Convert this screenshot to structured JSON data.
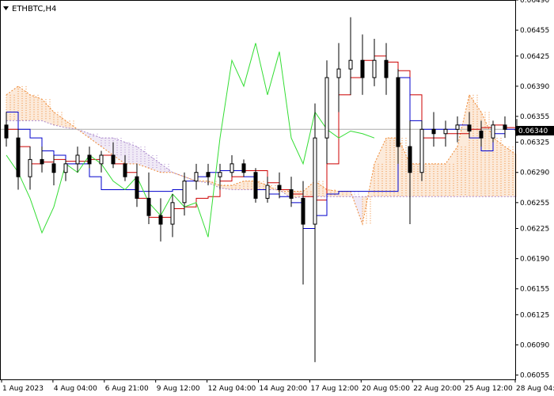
{
  "chart_data": {
    "type": "candlestick",
    "title": "ETHBTC,H4",
    "current_price": "0.06340",
    "ylim": [
      0.0605,
      0.0649
    ],
    "y_ticks": [
      "0.06490",
      "0.06455",
      "0.06425",
      "0.06390",
      "0.06355",
      "0.06325",
      "0.06290",
      "0.06255",
      "0.06225",
      "0.06190",
      "0.06155",
      "0.06125",
      "0.06090",
      "0.06055"
    ],
    "x_ticks": [
      "1 Aug 2023",
      "4 Aug 04:00",
      "6 Aug 21:00",
      "9 Aug 12:00",
      "12 Aug 04:00",
      "14 Aug 20:00",
      "17 Aug 12:00",
      "20 Aug 05:00",
      "22 Aug 20:00",
      "25 Aug 12:00",
      "28 Aug 04:00"
    ],
    "colors": {
      "candle": "#000000",
      "tenkan_sen": "#cc0000",
      "kijun_sen": "#0000cc",
      "chikou_span": "#33dd33",
      "cloud_up": "#ee8833",
      "cloud_down": "#aa88cc",
      "price_line": "#aaaaaa",
      "axis": "#000000"
    },
    "series": [
      {
        "name": "Tenkan-sen",
        "values": [
          0.0634,
          0.0632,
          0.063,
          0.06302,
          0.06305,
          0.06303,
          0.06303,
          0.06305,
          0.0631,
          0.063,
          0.0629,
          0.0626,
          0.06238,
          0.06238,
          0.06248,
          0.0625,
          0.0626,
          0.06262,
          0.0628,
          0.06285,
          0.06292,
          0.06292,
          0.06278,
          0.0627,
          0.06265,
          0.06262,
          0.06258,
          0.063,
          0.0638,
          0.064,
          0.0642,
          0.06425,
          0.06418,
          0.06408,
          0.0638,
          0.0633,
          0.0633,
          0.06335,
          0.06335,
          0.0634,
          0.06342,
          0.06345,
          0.06342,
          0.06338
        ]
      },
      {
        "name": "Kijun-sen",
        "values": [
          0.0636,
          0.0634,
          0.0633,
          0.06315,
          0.0631,
          0.063,
          0.063,
          0.06285,
          0.0627,
          0.0627,
          0.0627,
          0.06268,
          0.06268,
          0.06268,
          0.0627,
          0.0628,
          0.06285,
          0.0629,
          0.06292,
          0.06292,
          0.06285,
          0.0627,
          0.06265,
          0.06262,
          0.06255,
          0.06225,
          0.0624,
          0.06265,
          0.06268,
          0.06268,
          0.06268,
          0.06268,
          0.06268,
          0.064,
          0.0635,
          0.0634,
          0.0634,
          0.0634,
          0.06345,
          0.0633,
          0.06315,
          0.06335,
          0.0634,
          0.0634
        ]
      },
      {
        "name": "Chikou Span",
        "values": [
          0.0631,
          0.0629,
          0.0626,
          0.0622,
          0.0625,
          0.063,
          0.0629,
          0.0631,
          0.063,
          0.0628,
          0.0627,
          0.06285,
          0.06255,
          0.0624,
          0.06265,
          0.0625,
          0.06255,
          0.06215,
          0.0633,
          0.0642,
          0.0639,
          0.0644,
          0.0638,
          0.0643,
          0.0633,
          0.063,
          0.0636,
          0.0634,
          0.0633,
          0.06338,
          0.06335,
          0.0633
        ]
      },
      {
        "name": "Senkou Span A",
        "values": [
          0.0638,
          0.0639,
          0.0638,
          0.06375,
          0.0636,
          0.0635,
          0.0634,
          0.0633,
          0.0632,
          0.0631,
          0.063,
          0.063,
          0.06295,
          0.0629,
          0.0629,
          0.06285,
          0.0628,
          0.0628,
          0.06275,
          0.06275,
          0.0628,
          0.0628,
          0.06275,
          0.06268,
          0.06268,
          0.06268,
          0.0628,
          0.0627,
          0.06268,
          0.06268,
          0.0623,
          0.063,
          0.0633,
          0.0633,
          0.063,
          0.063,
          0.063,
          0.063,
          0.0632,
          0.0638,
          0.0636,
          0.0633,
          0.0632,
          0.0631
        ]
      },
      {
        "name": "Senkou Span B",
        "values": [
          0.0635,
          0.0635,
          0.0635,
          0.0635,
          0.06345,
          0.06342,
          0.0634,
          0.06335,
          0.0633,
          0.0633,
          0.06325,
          0.0632,
          0.0631,
          0.063,
          0.0629,
          0.06285,
          0.0628,
          0.06278,
          0.06272,
          0.0627,
          0.0627,
          0.0627,
          0.0627,
          0.0627,
          0.0626,
          0.06262,
          0.06262,
          0.06262,
          0.06262,
          0.06262,
          0.06262,
          0.06262,
          0.06262,
          0.06262,
          0.06262,
          0.06262,
          0.06262,
          0.06262,
          0.06262,
          0.06262,
          0.06262,
          0.06262,
          0.06262,
          0.06262
        ]
      }
    ],
    "candles": [
      [
        0.06345,
        0.0636,
        0.0632,
        0.0633
      ],
      [
        0.0633,
        0.0634,
        0.0627,
        0.06285
      ],
      [
        0.06285,
        0.0632,
        0.0627,
        0.06305
      ],
      [
        0.06305,
        0.0632,
        0.0629,
        0.063
      ],
      [
        0.063,
        0.0631,
        0.06275,
        0.0629
      ],
      [
        0.0629,
        0.06305,
        0.0628,
        0.063
      ],
      [
        0.063,
        0.0632,
        0.0629,
        0.0631
      ],
      [
        0.0631,
        0.0632,
        0.06295,
        0.063
      ],
      [
        0.063,
        0.06315,
        0.0629,
        0.0631
      ],
      [
        0.0631,
        0.06325,
        0.06295,
        0.063
      ],
      [
        0.063,
        0.0631,
        0.0628,
        0.06285
      ],
      [
        0.06285,
        0.063,
        0.0625,
        0.0626
      ],
      [
        0.0626,
        0.0629,
        0.0623,
        0.0624
      ],
      [
        0.0624,
        0.0626,
        0.0621,
        0.0623
      ],
      [
        0.0623,
        0.06265,
        0.06215,
        0.06255
      ],
      [
        0.06255,
        0.0629,
        0.0624,
        0.0628
      ],
      [
        0.0628,
        0.063,
        0.0627,
        0.0629
      ],
      [
        0.0629,
        0.063,
        0.06275,
        0.06285
      ],
      [
        0.06285,
        0.063,
        0.0627,
        0.0629
      ],
      [
        0.0629,
        0.0631,
        0.06285,
        0.063
      ],
      [
        0.063,
        0.06305,
        0.06285,
        0.0629
      ],
      [
        0.0629,
        0.06295,
        0.06255,
        0.0626
      ],
      [
        0.0626,
        0.06285,
        0.06255,
        0.06275
      ],
      [
        0.06275,
        0.0629,
        0.0626,
        0.0627
      ],
      [
        0.0627,
        0.06285,
        0.0625,
        0.0626
      ],
      [
        0.0626,
        0.0628,
        0.0616,
        0.0623
      ],
      [
        0.0623,
        0.0637,
        0.0607,
        0.0633
      ],
      [
        0.0633,
        0.0642,
        0.063,
        0.064
      ],
      [
        0.064,
        0.0644,
        0.0636,
        0.0641
      ],
      [
        0.0641,
        0.0647,
        0.0638,
        0.0642
      ],
      [
        0.0642,
        0.0645,
        0.0638,
        0.064
      ],
      [
        0.064,
        0.06445,
        0.0639,
        0.0642
      ],
      [
        0.0642,
        0.0644,
        0.0638,
        0.064
      ],
      [
        0.064,
        0.0641,
        0.063,
        0.0632
      ],
      [
        0.0632,
        0.0635,
        0.0623,
        0.0629
      ],
      [
        0.0629,
        0.0635,
        0.0628,
        0.0634
      ],
      [
        0.0634,
        0.0636,
        0.0632,
        0.06335
      ],
      [
        0.06335,
        0.0635,
        0.0632,
        0.0634
      ],
      [
        0.0634,
        0.06355,
        0.06325,
        0.06345
      ],
      [
        0.06345,
        0.0636,
        0.0633,
        0.06338
      ],
      [
        0.06338,
        0.0635,
        0.0632,
        0.0633
      ],
      [
        0.0633,
        0.0635,
        0.06325,
        0.06345
      ],
      [
        0.06345,
        0.06355,
        0.0633,
        0.0634
      ],
      [
        0.0634,
        0.06352,
        0.06332,
        0.0634
      ]
    ]
  }
}
